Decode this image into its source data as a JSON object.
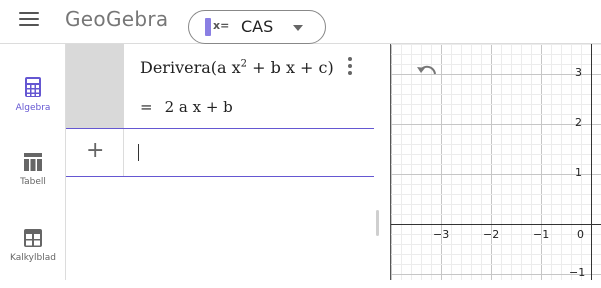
{
  "header": {
    "logo": "GeoGebra",
    "app_icon_text": "x=",
    "app_label": "CAS"
  },
  "sidebar": {
    "items": [
      {
        "label": "Algebra",
        "icon": "calculator-icon"
      },
      {
        "label": "Tabell",
        "icon": "table-icon"
      },
      {
        "label": "Kalkylblad",
        "icon": "spreadsheet-icon"
      }
    ]
  },
  "algebra": {
    "row1_input_prefix": "Derivera",
    "row1_input_open": "(a x",
    "row1_input_exp": "2",
    "row1_input_rest": " + b x + c)",
    "row1_eq": "=",
    "row1_output": "2 a x + b",
    "row2_plus": "+"
  },
  "graphics": {
    "y_ticks": [
      "3",
      "2",
      "1",
      "−1"
    ],
    "x_ticks": [
      "−3",
      "−2",
      "−1",
      "0"
    ]
  },
  "colors": {
    "accent": "#6557d2",
    "app_icon_bar": "#8a7fe3"
  }
}
